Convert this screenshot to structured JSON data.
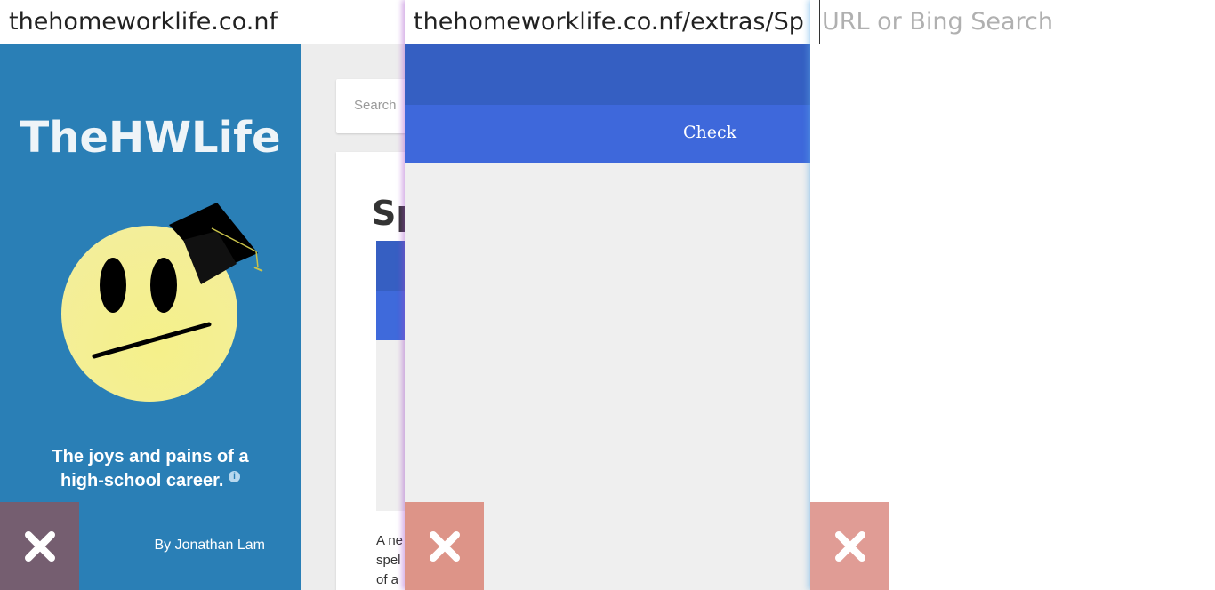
{
  "panes": [
    {
      "url": "thehomeworklife.co.nf",
      "site": {
        "title": "TheHWLife",
        "tagline": "The joys and pains of a high-school career.",
        "info_icon": "i",
        "author": "By Jonathan Lam",
        "search_placeholder": "Search",
        "article_title_partial": "Sp",
        "article_text_partial": "A ne\nspel\nof a"
      }
    },
    {
      "url": "thehomeworklife.co.nf/extras/Sp",
      "app": {
        "check_label": "Check"
      }
    },
    {
      "url_placeholder": "URL or Bing Search"
    }
  ],
  "close_icon": "close-icon",
  "colors": {
    "sidebar": "#2a7fb6",
    "header": "#355fc2",
    "toolbar": "#3e68db",
    "close1": "#755e70",
    "close2": "#dd9488",
    "close3": "#e09c95"
  }
}
